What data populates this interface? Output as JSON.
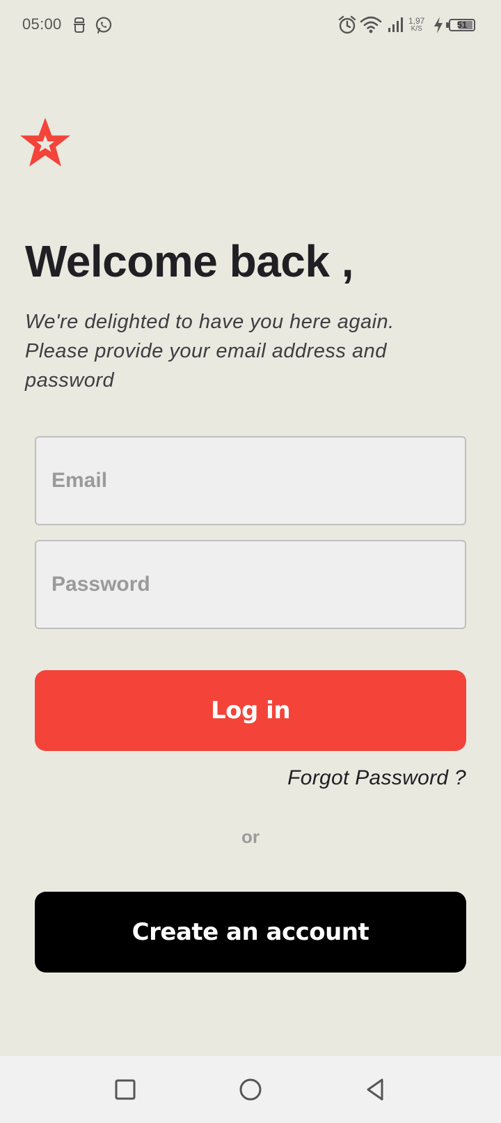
{
  "status_bar": {
    "time": "05:00",
    "net_speed_value": "1,97",
    "net_speed_unit": "K/S",
    "battery_level": "51",
    "icons": [
      "notification-icon",
      "whatsapp-icon",
      "alarm-icon",
      "wifi-icon",
      "signal-icon",
      "charging-icon",
      "battery-icon"
    ]
  },
  "brand": {
    "logo_icon": "star-icon",
    "accent_color": "#f44339"
  },
  "header": {
    "title": "Welcome back ,",
    "subtitle": "We're delighted to have you here again. Please provide your email address and password"
  },
  "form": {
    "email_placeholder": "Email",
    "email_value": "",
    "password_placeholder": "Password",
    "password_value": ""
  },
  "actions": {
    "login_label": "Log in",
    "forgot_label": "Forgot Password ?",
    "or_label": "or",
    "create_account_label": "Create an account"
  },
  "nav_bar": {
    "icons": [
      "recent-apps-icon",
      "home-icon",
      "back-icon"
    ]
  }
}
